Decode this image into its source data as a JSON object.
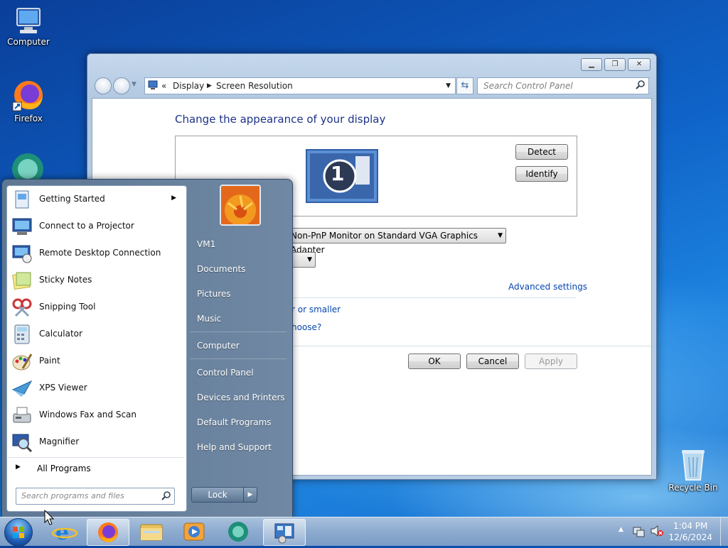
{
  "desktop": {
    "icons": [
      {
        "label": "Computer",
        "icon": "computer-icon"
      },
      {
        "label": "Firefox",
        "icon": "firefox-icon"
      },
      {
        "label": "Recycle Bin",
        "icon": "recycle-bin-icon"
      }
    ]
  },
  "window": {
    "address": {
      "prefix": "«",
      "crumb1": "Display",
      "crumb2": "Screen Resolution"
    },
    "search_placeholder": "Search Control Panel",
    "heading": "Change the appearance of your display",
    "monitor_number": "1",
    "detect_label": "Detect",
    "identify_label": "Identify",
    "display_value": "Non-PnP Monitor on Standard VGA Graphics Adapter",
    "advanced_settings": "Advanced settings",
    "link_smaller": "r or smaller",
    "link_choose": "hoose?",
    "ok_label": "OK",
    "cancel_label": "Cancel",
    "apply_label": "Apply"
  },
  "start_menu": {
    "programs": [
      {
        "label": "Getting Started",
        "icon": "getting-started-icon",
        "submenu": true
      },
      {
        "label": "Connect to a Projector",
        "icon": "projector-icon"
      },
      {
        "label": "Remote Desktop Connection",
        "icon": "remote-desktop-icon"
      },
      {
        "label": "Sticky Notes",
        "icon": "sticky-notes-icon"
      },
      {
        "label": "Snipping Tool",
        "icon": "snipping-tool-icon"
      },
      {
        "label": "Calculator",
        "icon": "calculator-icon"
      },
      {
        "label": "Paint",
        "icon": "paint-icon"
      },
      {
        "label": "XPS Viewer",
        "icon": "xps-viewer-icon"
      },
      {
        "label": "Windows Fax and Scan",
        "icon": "fax-scan-icon"
      },
      {
        "label": "Magnifier",
        "icon": "magnifier-icon"
      }
    ],
    "all_programs": "All Programs",
    "search_placeholder": "Search programs and files",
    "right_links": [
      "VM1",
      "Documents",
      "Pictures",
      "Music",
      "Computer",
      "Control Panel",
      "Devices and Printers",
      "Default Programs",
      "Help and Support"
    ],
    "lock_label": "Lock"
  },
  "taskbar": {
    "time": "1:04 PM",
    "date": "12/6/2024"
  },
  "colors": {
    "accent": "#1e3287",
    "link": "#0645ad"
  }
}
